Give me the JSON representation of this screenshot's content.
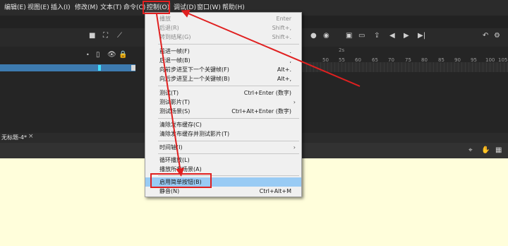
{
  "menubar": {
    "items": [
      "编辑(E)",
      "视图(E)",
      "插入(I)",
      "修改(M)",
      "文本(T)",
      "命令(C)",
      "控制(O)",
      "调试(D)",
      "窗口(W)",
      "帮助(H)"
    ]
  },
  "timeline": {
    "ruler_marks": [
      "2s",
      "50",
      "55",
      "60",
      "65",
      "70",
      "75",
      "80",
      "85",
      "90",
      "95",
      "100",
      "105"
    ]
  },
  "document": {
    "tab_title": "无标题-4*",
    "tab_close": "×"
  },
  "control_menu": {
    "items": [
      {
        "label": "播放",
        "shortcut": "Enter",
        "disabled": true
      },
      {
        "label": "后退(R)",
        "shortcut": "Shift+,",
        "disabled": true
      },
      {
        "label": "转到结尾(G)",
        "shortcut": "Shift+.",
        "disabled": true
      },
      {
        "label": "前进一帧(F)",
        "shortcut": ".",
        "disabled": false
      },
      {
        "label": "后退一帧(B)",
        "shortcut": ",",
        "disabled": false
      },
      {
        "label": "向前步进至下一个关键帧(F)",
        "shortcut": "Alt+.",
        "disabled": false
      },
      {
        "label": "向后步进至上一个关键帧(B)",
        "shortcut": "Alt+,",
        "disabled": false
      },
      {
        "label": "测试(T)",
        "shortcut": "Ctrl+Enter (数字)",
        "disabled": false
      },
      {
        "label": "测试影片(T)",
        "shortcut": "",
        "disabled": false,
        "submenu": true
      },
      {
        "label": "测试场景(S)",
        "shortcut": "Ctrl+Alt+Enter (数字)",
        "disabled": false
      },
      {
        "label": "清除发布缓存(C)",
        "shortcut": "",
        "disabled": false
      },
      {
        "label": "清除发布缓存并测试影片(T)",
        "shortcut": "",
        "disabled": false
      },
      {
        "label": "时间轴(I)",
        "shortcut": "",
        "disabled": false,
        "submenu": true
      },
      {
        "label": "循环播放(L)",
        "shortcut": "",
        "disabled": false
      },
      {
        "label": "播放所有场景(A)",
        "shortcut": "",
        "disabled": false
      },
      {
        "label": "启用简单按钮(B)",
        "shortcut": "",
        "disabled": false,
        "highlighted": true
      },
      {
        "label": "静音(N)",
        "shortcut": "Ctrl+Alt+M",
        "disabled": false
      }
    ],
    "submenu_arrow": "›"
  },
  "colors": {
    "annotation_red": "#e02020",
    "highlight": "#99cbf4",
    "stage": "#fffedb",
    "layer_selected": "#3d7bb0"
  }
}
